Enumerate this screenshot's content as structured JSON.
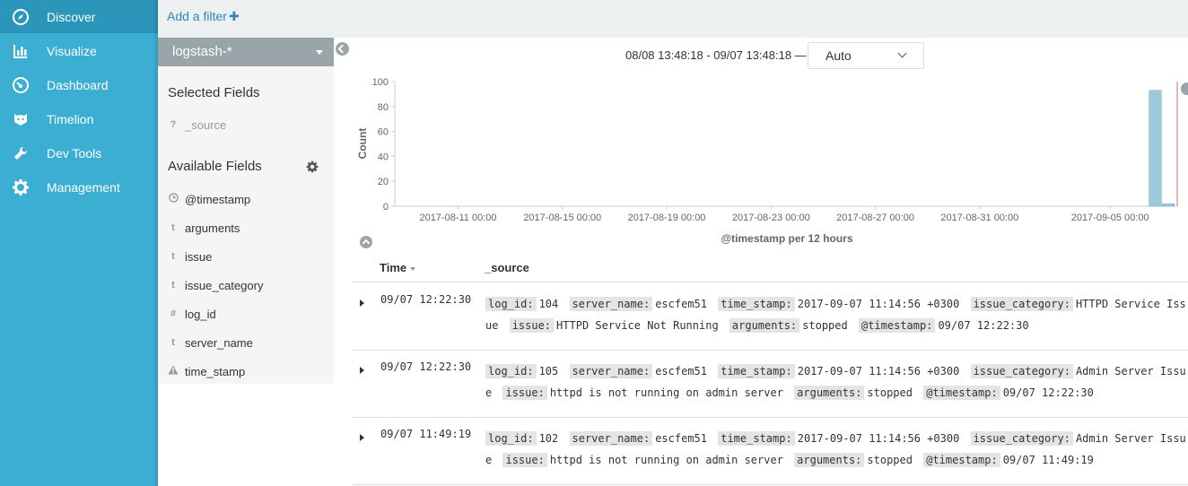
{
  "nav": {
    "items": [
      {
        "label": "Discover",
        "icon": "compass-icon",
        "active": true
      },
      {
        "label": "Visualize",
        "icon": "bar-chart-icon",
        "active": false
      },
      {
        "label": "Dashboard",
        "icon": "gauge-icon",
        "active": false
      },
      {
        "label": "Timelion",
        "icon": "timelion-icon",
        "active": false
      },
      {
        "label": "Dev Tools",
        "icon": "wrench-icon",
        "active": false
      },
      {
        "label": "Management",
        "icon": "gear-icon",
        "active": false
      }
    ]
  },
  "filterbar": {
    "add_filter_label": "Add a filter",
    "plus": "✚"
  },
  "sidebar": {
    "index_pattern": "logstash-*",
    "selected_title": "Selected Fields",
    "selected_fields": [
      {
        "type": "?",
        "name": "_source"
      }
    ],
    "available_title": "Available Fields",
    "available_fields": [
      {
        "type": "clock",
        "name": "@timestamp"
      },
      {
        "type": "t",
        "name": "arguments"
      },
      {
        "type": "t",
        "name": "issue"
      },
      {
        "type": "t",
        "name": "issue_category"
      },
      {
        "type": "#",
        "name": "log_id"
      },
      {
        "type": "t",
        "name": "server_name"
      },
      {
        "type": "warning",
        "name": "time_stamp"
      }
    ]
  },
  "time_range": "08/08 13:48:18 - 09/07 13:48:18 —",
  "interval": {
    "selected": "Auto"
  },
  "colors": {
    "nav_bg": "#3caed2",
    "nav_active": "#2c96ba",
    "bar": "#9dc9da",
    "marker": "#e07070"
  },
  "chart_data": {
    "type": "bar",
    "ylabel": "Count",
    "xlabel": "@timestamp per 12 hours",
    "ylim": [
      0,
      100
    ],
    "yticks": [
      0,
      20,
      40,
      60,
      80,
      100
    ],
    "xticks": [
      "2017-08-11 00:00",
      "2017-08-15 00:00",
      "2017-08-19 00:00",
      "2017-08-23 00:00",
      "2017-08-27 00:00",
      "2017-08-31 00:00",
      "2017-09-05 00:00"
    ],
    "x_start": "2017-08-08 13:48:18",
    "x_end": "2017-09-07 13:48:18",
    "bars": [
      {
        "x": "2017-09-06 12:00",
        "value": 93
      },
      {
        "x": "2017-09-07 00:00",
        "value": 2
      }
    ],
    "grid": false
  },
  "table": {
    "columns": {
      "time": "Time",
      "source": "_source"
    },
    "rows": [
      {
        "time": "09/07 12:22:30",
        "fields": [
          {
            "k": "log_id:",
            "v": "104"
          },
          {
            "k": "server_name:",
            "v": "escfem51"
          },
          {
            "k": "time_stamp:",
            "v": "2017-09-07 11:14:56 +0300"
          },
          {
            "k": "issue_category:",
            "v": "HTTPD Service Issue"
          },
          {
            "k": "issue:",
            "v": "HTTPD Service Not Running"
          },
          {
            "k": "arguments:",
            "v": "stopped"
          },
          {
            "k": "@timestamp:",
            "v": "09/07 12:22:30"
          }
        ]
      },
      {
        "time": "09/07 12:22:30",
        "fields": [
          {
            "k": "log_id:",
            "v": "105"
          },
          {
            "k": "server_name:",
            "v": "escfem51"
          },
          {
            "k": "time_stamp:",
            "v": "2017-09-07 11:14:56 +0300"
          },
          {
            "k": "issue_category:",
            "v": "Admin Server Issue"
          },
          {
            "k": "issue:",
            "v": "httpd is not running on admin server"
          },
          {
            "k": "arguments:",
            "v": "stopped"
          },
          {
            "k": "@timestamp:",
            "v": "09/07 12:22:30"
          }
        ]
      },
      {
        "time": "09/07 11:49:19",
        "fields": [
          {
            "k": "log_id:",
            "v": "102"
          },
          {
            "k": "server_name:",
            "v": "escfem51"
          },
          {
            "k": "time_stamp:",
            "v": "2017-09-07 11:14:56 +0300"
          },
          {
            "k": "issue_category:",
            "v": "Admin Server Issue"
          },
          {
            "k": "issue:",
            "v": "httpd is not running on admin server"
          },
          {
            "k": "arguments:",
            "v": "stopped"
          },
          {
            "k": "@timestamp:",
            "v": "09/07 11:49:19"
          }
        ]
      }
    ]
  }
}
